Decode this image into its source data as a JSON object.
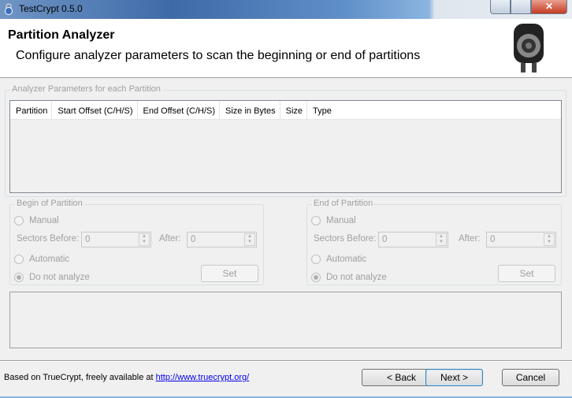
{
  "window": {
    "title": "TestCrypt 0.5.0"
  },
  "header": {
    "title": "Partition Analyzer",
    "subtitle": "Configure analyzer parameters to scan the beginning or end of partitions"
  },
  "params": {
    "label": "Analyzer Parameters for each Partition",
    "columns": [
      "Partition",
      "Start Offset (C/H/S)",
      "End Offset (C/H/S)",
      "Size in Bytes",
      "Size",
      "Type"
    ]
  },
  "begin": {
    "label": "Begin of Partition",
    "manual": "Manual",
    "sectors_before": "Sectors Before:",
    "before_value": "0",
    "after": "After:",
    "after_value": "0",
    "automatic": "Automatic",
    "no_analyze": "Do not analyze",
    "set": "Set",
    "selected": "Do not analyze"
  },
  "end": {
    "label": "End of Partition",
    "manual": "Manual",
    "sectors_before": "Sectors Before:",
    "before_value": "0",
    "after": "After:",
    "after_value": "0",
    "automatic": "Automatic",
    "no_analyze": "Do not analyze",
    "set": "Set",
    "selected": "Do not analyze"
  },
  "footer": {
    "text": "Based on TrueCrypt, freely available at ",
    "link": "http://www.truecrypt.org/",
    "back": "< Back",
    "next": "Next >",
    "cancel": "Cancel"
  }
}
